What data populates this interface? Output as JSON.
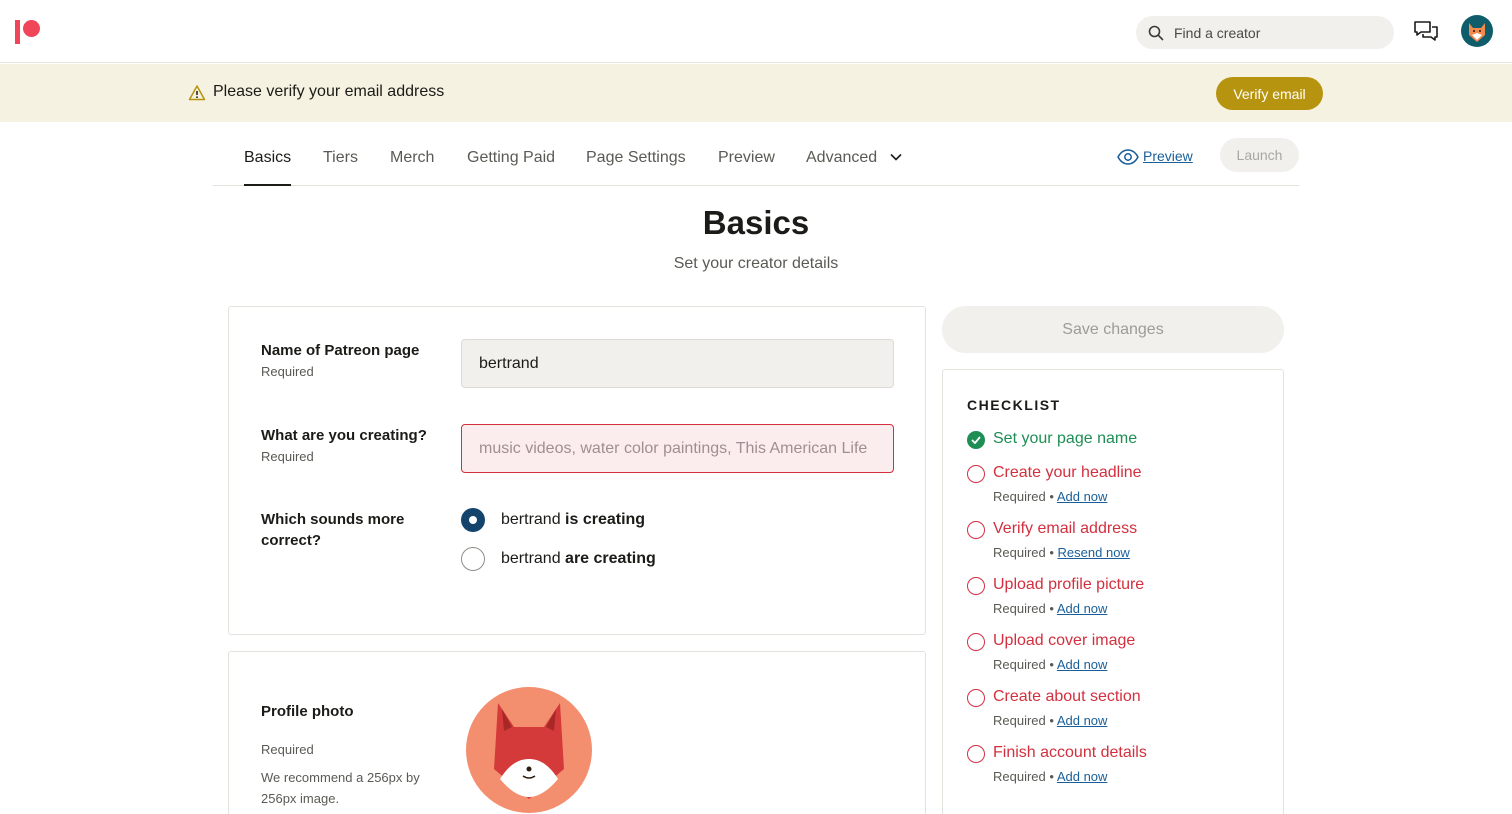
{
  "header": {
    "search_placeholder": "Find a creator",
    "icons": [
      "patreon-logo",
      "search-icon",
      "chat-icon",
      "avatar"
    ]
  },
  "banner": {
    "message": "Please verify your email address",
    "button": "Verify email"
  },
  "tabs": {
    "items": [
      "Basics",
      "Tiers",
      "Merch",
      "Getting Paid",
      "Page Settings",
      "Preview",
      "Advanced"
    ],
    "active": "Basics",
    "preview_link": "Preview",
    "launch": "Launch"
  },
  "page": {
    "title": "Basics",
    "subtitle": "Set your creator details"
  },
  "form": {
    "name_label": "Name of Patreon page",
    "name_required": "Required",
    "name_value": "bertrand",
    "creating_label": "What are you creating?",
    "creating_required": "Required",
    "creating_placeholder": "music videos, water color paintings, This American Life",
    "sounds_label_1": "Which sounds more",
    "sounds_label_2": "correct?",
    "option_1_name": "bertrand",
    "option_1_verb": "is creating",
    "option_2_name": "bertrand",
    "option_2_verb": "are creating",
    "selected_option": 1
  },
  "profile": {
    "label": "Profile photo",
    "required": "Required",
    "hint_1": "We recommend a 256px by",
    "hint_2": "256px image."
  },
  "sidebar": {
    "save_button": "Save changes",
    "checklist_title": "CHECKLIST",
    "items": [
      {
        "label": "Set your page name",
        "done": true,
        "required": "",
        "link": ""
      },
      {
        "label": "Create your headline",
        "done": false,
        "required": "Required",
        "link": "Add now"
      },
      {
        "label": "Verify email address",
        "done": false,
        "required": "Required",
        "link": "Resend now"
      },
      {
        "label": "Upload profile picture",
        "done": false,
        "required": "Required",
        "link": "Add now"
      },
      {
        "label": "Upload cover image",
        "done": false,
        "required": "Required",
        "link": "Add now"
      },
      {
        "label": "Create about section",
        "done": false,
        "required": "Required",
        "link": "Add now"
      },
      {
        "label": "Finish account details",
        "done": false,
        "required": "Required",
        "link": "Add now"
      }
    ]
  },
  "colors": {
    "brand": "#f1465a",
    "banner_bg": "#f6f2e1",
    "verify_button": "#b7940f",
    "error": "#d2303e",
    "success": "#1f8e55",
    "link": "#1a5f99",
    "radio_selected": "#14436b"
  }
}
